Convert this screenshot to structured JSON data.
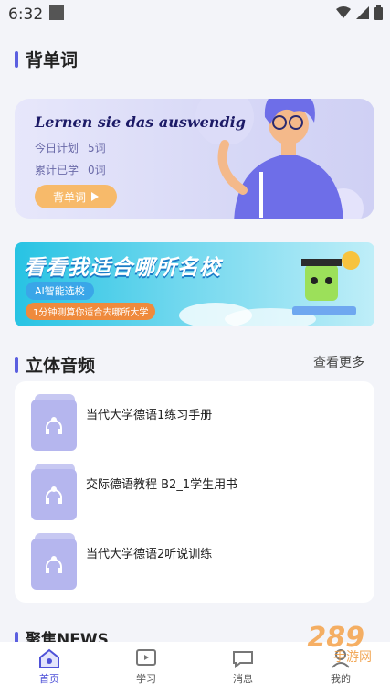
{
  "status": {
    "time": "6:32"
  },
  "words": {
    "title": "背单词",
    "motto": "Lernen sie das auswendig",
    "plan_label": "今日计划",
    "plan_value": "5词",
    "learned_label": "累计已学",
    "learned_value": "0词",
    "button": "背单词"
  },
  "banner": {
    "headline": "看看我适合哪所名校",
    "ai_tag": "AI智能选校",
    "subtitle": "1分钟测算你适合去哪所大学"
  },
  "audio": {
    "title": "立体音频",
    "more": "查看更多",
    "items": [
      {
        "name": "当代大学德语1练习手册"
      },
      {
        "name": "交际德语教程 B2_1学生用书"
      },
      {
        "name": "当代大学德语2听说训练"
      }
    ]
  },
  "next_section": {
    "title": "聚焦NEWS"
  },
  "tabs": [
    {
      "label": "首页",
      "icon": "home-icon",
      "active": true
    },
    {
      "label": "学习",
      "icon": "study-icon",
      "active": false
    },
    {
      "label": "消息",
      "icon": "message-icon",
      "active": false
    },
    {
      "label": "我的",
      "icon": "profile-icon",
      "active": false
    }
  ],
  "watermark": {
    "logo": "289",
    "text": "手游网"
  },
  "colors": {
    "accent": "#5b5fe0",
    "button": "#f7ba6a",
    "thumb": "#b5b6ee"
  }
}
